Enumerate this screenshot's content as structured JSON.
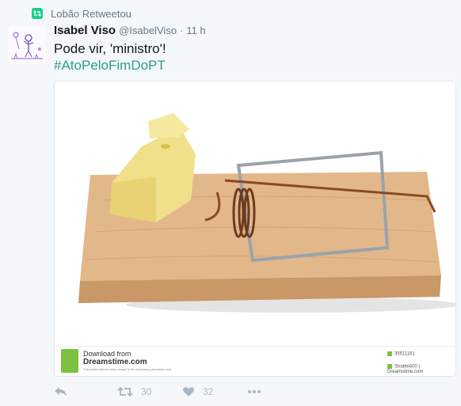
{
  "retweet": {
    "label": "Lobão Retweetou",
    "icon": "retweet-icon"
  },
  "tweet": {
    "author_name": "Isabel Viso",
    "author_handle": "@IsabelViso",
    "separator": "·",
    "time": "11 h",
    "text": "Pode vir, 'ministro'!",
    "hashtag": "#AtoPeloFimDoPT"
  },
  "media": {
    "description_icon": "mousetrap-photo",
    "watermark": {
      "line1": "Download from",
      "line2": "Dreamstime.com",
      "line3": "This watermarked comp image is for previewing purposes only.",
      "id": "35511161",
      "credit": "Sirable400 | Dreamstime.com"
    }
  },
  "actions": {
    "reply_icon": "reply-icon",
    "retweet_icon": "retweet-icon",
    "retweet_count": "30",
    "like_icon": "heart-icon",
    "like_count": "32",
    "more_icon": "more-icon"
  },
  "colors": {
    "retweet_green": "#19cf86",
    "hashtag": "#2a9d8f",
    "muted": "#657786",
    "icon_gray": "#aab8c2"
  }
}
